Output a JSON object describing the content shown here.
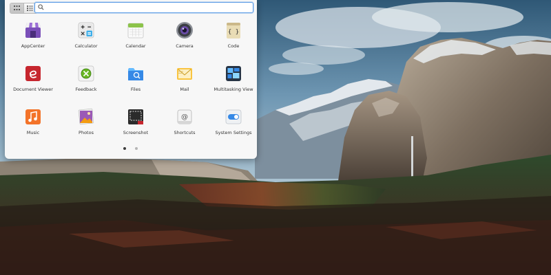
{
  "search": {
    "placeholder": "",
    "value": ""
  },
  "view_switch": {
    "grid_icon": "grid-view-icon",
    "category_icon": "category-view-icon",
    "active": "grid"
  },
  "apps": [
    {
      "label": "AppCenter",
      "icon": "appcenter-icon"
    },
    {
      "label": "Calculator",
      "icon": "calculator-icon"
    },
    {
      "label": "Calendar",
      "icon": "calendar-icon"
    },
    {
      "label": "Camera",
      "icon": "camera-icon"
    },
    {
      "label": "Code",
      "icon": "code-icon"
    },
    {
      "label": "Document Viewer",
      "icon": "document-viewer-icon"
    },
    {
      "label": "Feedback",
      "icon": "feedback-icon"
    },
    {
      "label": "Files",
      "icon": "files-icon"
    },
    {
      "label": "Mail",
      "icon": "mail-icon"
    },
    {
      "label": "Multitasking View",
      "icon": "multitasking-view-icon"
    },
    {
      "label": "Music",
      "icon": "music-icon"
    },
    {
      "label": "Photos",
      "icon": "photos-icon"
    },
    {
      "label": "Screenshot",
      "icon": "screenshot-icon"
    },
    {
      "label": "Shortcuts",
      "icon": "shortcuts-icon"
    },
    {
      "label": "System Settings",
      "icon": "system-settings-icon"
    }
  ],
  "pagination": {
    "pages": 2,
    "current": 1
  },
  "colors": {
    "accent": "#5f9ee6",
    "panel": "#f7f7f7"
  }
}
